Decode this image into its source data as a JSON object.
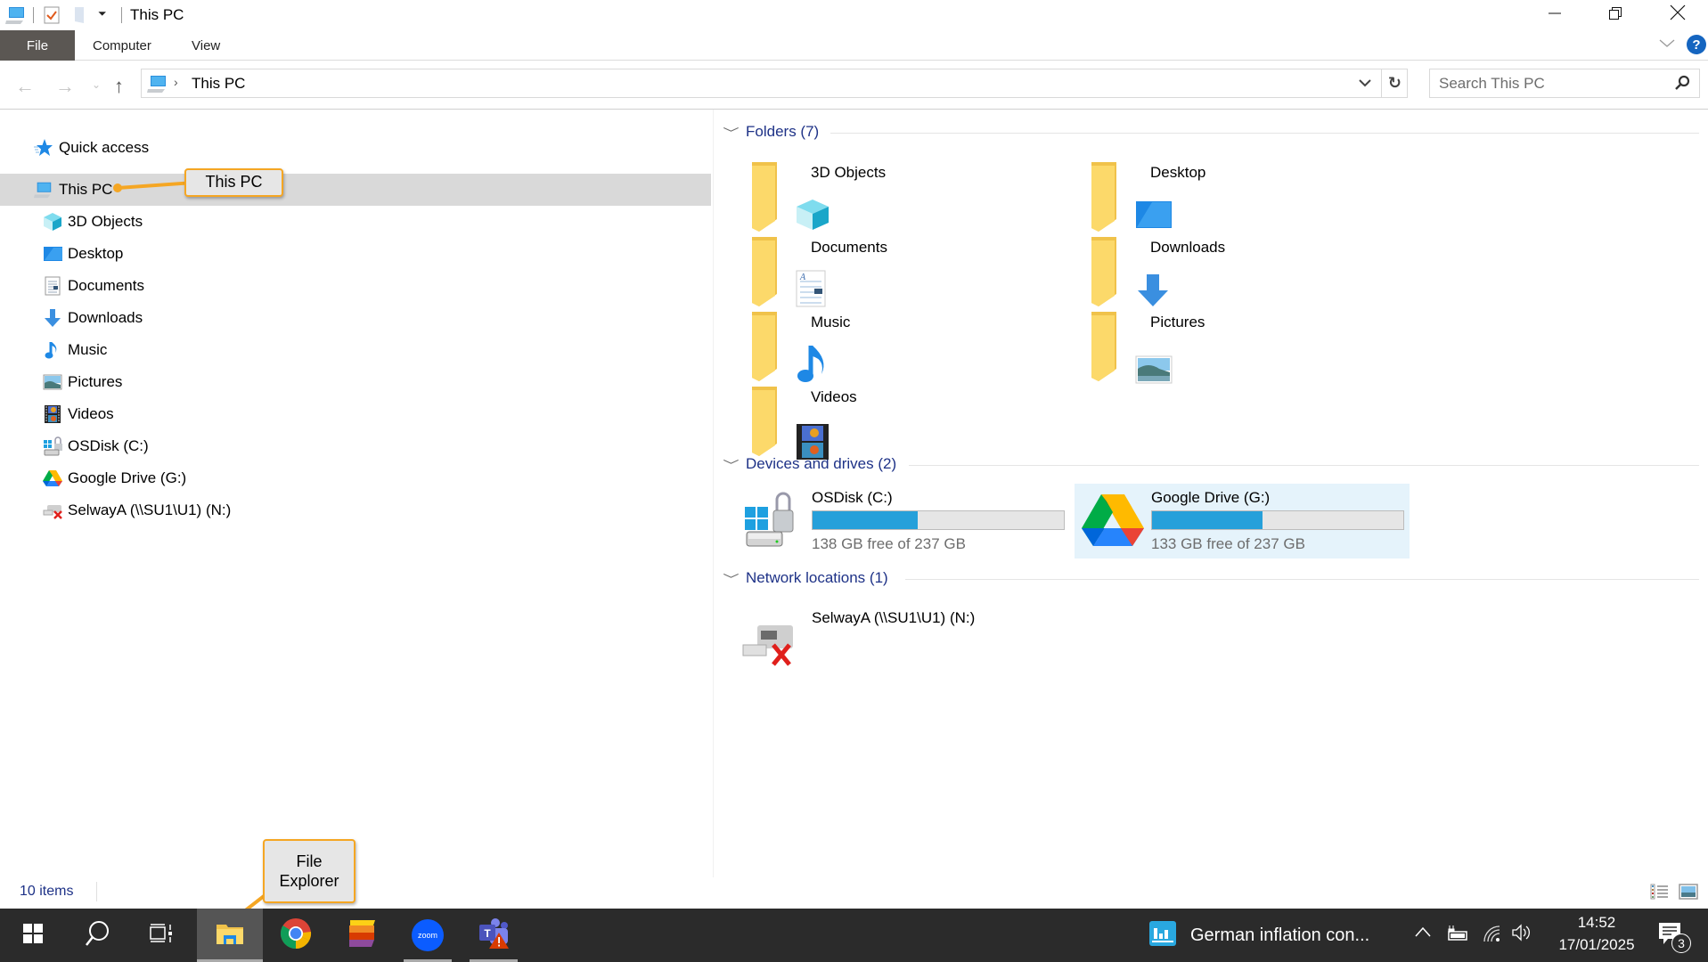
{
  "window": {
    "title": "This PC",
    "controls": {
      "minimize": "minimize-icon",
      "restore": "restore-icon",
      "close": "close-icon"
    }
  },
  "ribbon": {
    "tabs": [
      {
        "label": "File",
        "active": true
      },
      {
        "label": "Computer"
      },
      {
        "label": "View"
      }
    ]
  },
  "address": {
    "path": [
      "This PC"
    ],
    "search_placeholder": "Search This PC"
  },
  "nav": {
    "quick_access": "Quick access",
    "this_pc": "This PC",
    "items": [
      {
        "label": "3D Objects",
        "icon": "cube-icon"
      },
      {
        "label": "Desktop",
        "icon": "desktop-icon"
      },
      {
        "label": "Documents",
        "icon": "document-icon"
      },
      {
        "label": "Downloads",
        "icon": "download-arrow-icon"
      },
      {
        "label": "Music",
        "icon": "music-note-icon"
      },
      {
        "label": "Pictures",
        "icon": "picture-icon"
      },
      {
        "label": "Videos",
        "icon": "film-icon"
      },
      {
        "label": "OSDisk (C:)",
        "icon": "windows-drive-icon"
      },
      {
        "label": "Google Drive (G:)",
        "icon": "google-drive-icon"
      },
      {
        "label": "SelwayA (\\\\SU1\\U1) (N:)",
        "icon": "disconnected-network-drive-icon"
      }
    ]
  },
  "content": {
    "folders_header": "Folders (7)",
    "folders": [
      {
        "label": "3D Objects"
      },
      {
        "label": "Desktop"
      },
      {
        "label": "Documents"
      },
      {
        "label": "Downloads"
      },
      {
        "label": "Music"
      },
      {
        "label": "Pictures"
      },
      {
        "label": "Videos"
      }
    ],
    "drives_header": "Devices and drives (2)",
    "drives": [
      {
        "label": "OSDisk (C:)",
        "free": "138 GB free of 237 GB",
        "used_fraction": 0.418,
        "selected": false
      },
      {
        "label": "Google Drive (G:)",
        "free": "133 GB free of 237 GB",
        "used_fraction": 0.439,
        "selected": true
      }
    ],
    "network_header": "Network locations (1)",
    "network": [
      {
        "label": "SelwayA (\\\\SU1\\U1) (N:)"
      }
    ]
  },
  "status": {
    "items": "10 items"
  },
  "callouts": {
    "this_pc": "This PC",
    "file_explorer_line1": "File",
    "file_explorer_line2": "Explorer"
  },
  "taskbar": {
    "apps": [
      "Start",
      "Search",
      "Task View",
      "File Explorer",
      "Google Chrome",
      "Office app",
      "Zoom",
      "Microsoft Teams"
    ],
    "zoom_label": "zoom",
    "notification_app": "German inflation con...",
    "time": "14:52",
    "date": "17/01/2025",
    "notification_count": "3"
  },
  "colors": {
    "accent": "#26a0da",
    "header_text": "#1e3287",
    "selection": "#e5f3fb",
    "callout_border": "#f5a623"
  }
}
